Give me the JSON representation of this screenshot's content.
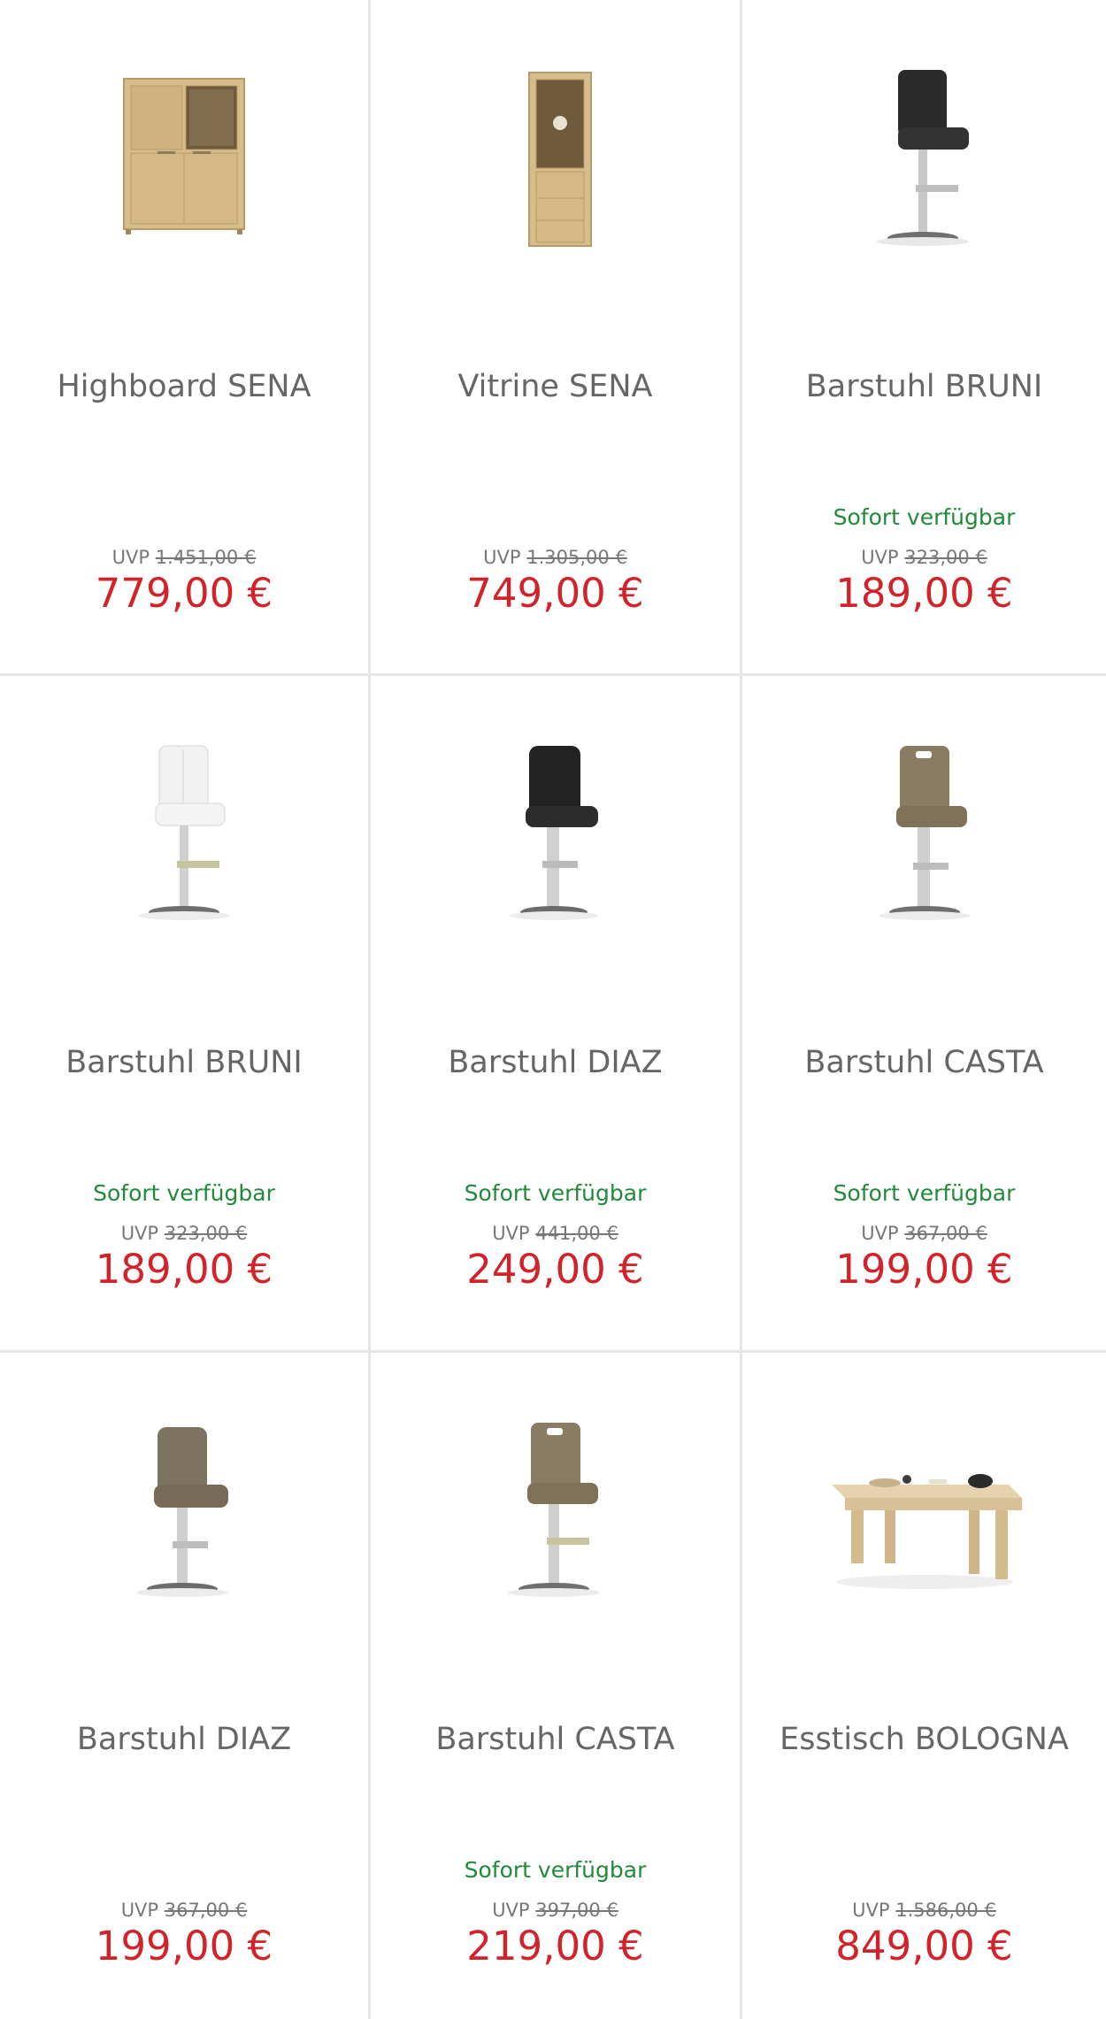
{
  "products": [
    {
      "title": "Highboard SENA",
      "availability": "",
      "uvp_label": "UVP",
      "uvp_price": "1.451,00 €",
      "price": "779,00 €",
      "image_icon": "highboard-image"
    },
    {
      "title": "Vitrine SENA",
      "availability": "",
      "uvp_label": "UVP",
      "uvp_price": "1.305,00 €",
      "price": "749,00 €",
      "image_icon": "vitrine-image"
    },
    {
      "title": "Barstuhl BRUNI",
      "availability": "Sofort verfügbar",
      "uvp_label": "UVP",
      "uvp_price": "323,00 €",
      "price": "189,00 €",
      "image_icon": "barstool-black-image"
    },
    {
      "title": "Barstuhl BRUNI",
      "availability": "Sofort verfügbar",
      "uvp_label": "UVP",
      "uvp_price": "323,00 €",
      "price": "189,00 €",
      "image_icon": "barstool-white-image"
    },
    {
      "title": "Barstuhl DIAZ",
      "availability": "Sofort verfügbar",
      "uvp_label": "UVP",
      "uvp_price": "441,00 €",
      "price": "249,00 €",
      "image_icon": "barstool-black-image"
    },
    {
      "title": "Barstuhl CASTA",
      "availability": "Sofort verfügbar",
      "uvp_label": "UVP",
      "uvp_price": "367,00 €",
      "price": "199,00 €",
      "image_icon": "barstool-taupe-image"
    },
    {
      "title": "Barstuhl DIAZ",
      "availability": "",
      "uvp_label": "UVP",
      "uvp_price": "367,00 €",
      "price": "199,00 €",
      "image_icon": "barstool-taupe-image"
    },
    {
      "title": "Barstuhl CASTA",
      "availability": "Sofort verfügbar",
      "uvp_label": "UVP",
      "uvp_price": "397,00 €",
      "price": "219,00 €",
      "image_icon": "barstool-taupe-image"
    },
    {
      "title": "Esstisch BOLOGNA",
      "availability": "",
      "uvp_label": "UVP",
      "uvp_price": "1.586,00 €",
      "price": "849,00 €",
      "image_icon": "dining-table-image"
    }
  ],
  "colors": {
    "price": "#d2232a",
    "availability": "#1f8a3a",
    "title": "#666666",
    "divider": "#e6e6e6"
  }
}
